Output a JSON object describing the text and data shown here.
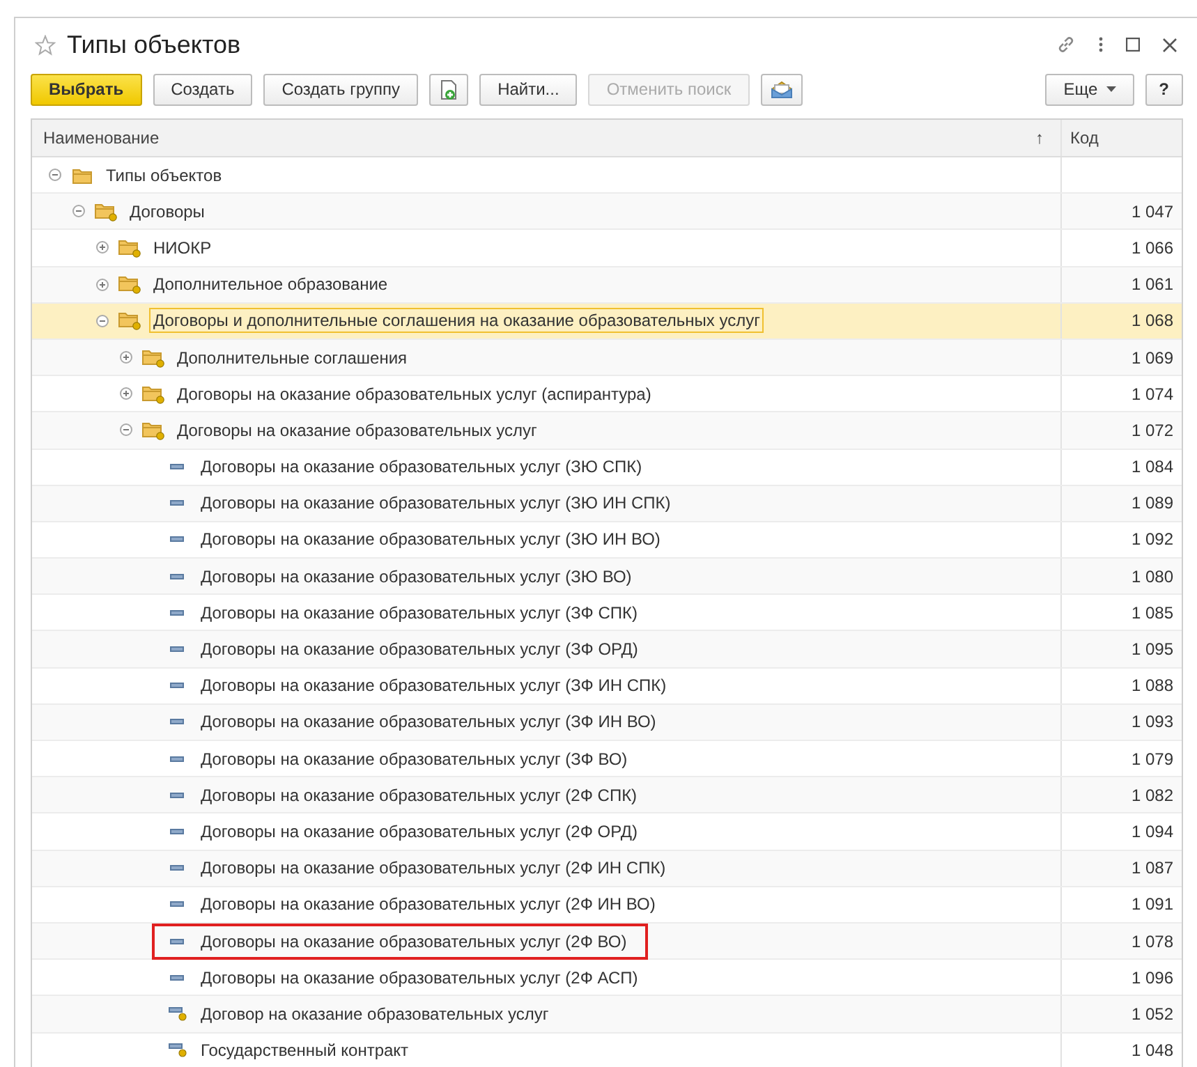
{
  "window": {
    "title": "Типы объектов"
  },
  "toolbar": [
    {
      "kind": "primary",
      "label": "Выбрать",
      "disabled": false
    },
    {
      "kind": "button",
      "label": "Создать",
      "disabled": false
    },
    {
      "kind": "button",
      "label": "Создать группу",
      "disabled": false
    },
    {
      "kind": "doc-icon"
    },
    {
      "kind": "button",
      "label": "Найти...",
      "disabled": false
    },
    {
      "kind": "button",
      "label": "Отменить поиск",
      "disabled": true
    },
    {
      "kind": "envelope-icon"
    }
  ],
  "toolbar_right": {
    "more": "Еще",
    "help": "?"
  },
  "table": {
    "columns": [
      {
        "label": "Наименование",
        "sort_mark": "↑"
      },
      {
        "label": "Код"
      }
    ],
    "rows": [
      {
        "kind": "root-group",
        "name": "Типы объектов",
        "code": "",
        "expanded": true,
        "selected": false,
        "circled": false,
        "children": [
          {
            "kind": "group",
            "name": "Договоры",
            "code": "1 047",
            "expanded": true,
            "selected": false,
            "circled": false,
            "children": [
              {
                "kind": "group",
                "name": "НИОКР",
                "code": "1 066",
                "expanded": false,
                "selected": false,
                "circled": false
              },
              {
                "kind": "group",
                "name": "Дополнительное образование",
                "code": "1 061",
                "expanded": false,
                "selected": false,
                "circled": false
              },
              {
                "kind": "group",
                "name": "Договоры и дополнительные соглашения на оказание образовательных услуг",
                "code": "1 068",
                "expanded": true,
                "selected": true,
                "circled": false,
                "children": [
                  {
                    "kind": "group",
                    "name": "Дополнительные соглашения",
                    "code": "1 069",
                    "expanded": false,
                    "selected": false,
                    "circled": false
                  },
                  {
                    "kind": "group",
                    "name": "Договоры на оказание образовательных услуг (аспирантура)",
                    "code": "1 074",
                    "expanded": false,
                    "selected": false,
                    "circled": false
                  },
                  {
                    "kind": "group",
                    "name": "Договоры на оказание образовательных услуг",
                    "code": "1 072",
                    "expanded": true,
                    "selected": false,
                    "circled": false,
                    "children": [
                      {
                        "kind": "item",
                        "name": "Договоры на оказание образовательных услуг (ЗЮ СПК)",
                        "code": "1 084",
                        "selected": false,
                        "circled": false
                      },
                      {
                        "kind": "item",
                        "name": "Договоры на оказание образовательных услуг (ЗЮ ИН СПК)",
                        "code": "1 089",
                        "selected": false,
                        "circled": false
                      },
                      {
                        "kind": "item",
                        "name": "Договоры на оказание образовательных услуг (ЗЮ ИН ВО)",
                        "code": "1 092",
                        "selected": false,
                        "circled": false
                      },
                      {
                        "kind": "item",
                        "name": "Договоры на оказание образовательных услуг (ЗЮ ВО)",
                        "code": "1 080",
                        "selected": false,
                        "circled": false
                      },
                      {
                        "kind": "item",
                        "name": "Договоры на оказание образовательных услуг (ЗФ СПК)",
                        "code": "1 085",
                        "selected": false,
                        "circled": false
                      },
                      {
                        "kind": "item",
                        "name": "Договоры на оказание образовательных услуг (ЗФ ОРД)",
                        "code": "1 095",
                        "selected": false,
                        "circled": false
                      },
                      {
                        "kind": "item",
                        "name": "Договоры на оказание образовательных услуг (ЗФ ИН СПК)",
                        "code": "1 088",
                        "selected": false,
                        "circled": false
                      },
                      {
                        "kind": "item",
                        "name": "Договоры на оказание образовательных услуг (ЗФ ИН ВО)",
                        "code": "1 093",
                        "selected": false,
                        "circled": false
                      },
                      {
                        "kind": "item",
                        "name": "Договоры на оказание образовательных услуг (ЗФ ВО)",
                        "code": "1 079",
                        "selected": false,
                        "circled": false
                      },
                      {
                        "kind": "item",
                        "name": "Договоры на оказание образовательных услуг (2Ф СПК)",
                        "code": "1 082",
                        "selected": false,
                        "circled": false
                      },
                      {
                        "kind": "item",
                        "name": "Договоры на оказание образовательных услуг (2Ф ОРД)",
                        "code": "1 094",
                        "selected": false,
                        "circled": false
                      },
                      {
                        "kind": "item",
                        "name": "Договоры на оказание образовательных услуг (2Ф ИН СПК)",
                        "code": "1 087",
                        "selected": false,
                        "circled": false
                      },
                      {
                        "kind": "item",
                        "name": "Договоры на оказание образовательных услуг (2Ф ИН ВО)",
                        "code": "1 091",
                        "selected": false,
                        "circled": false
                      },
                      {
                        "kind": "item",
                        "name": "Договоры на оказание образовательных услуг (2Ф ВО)",
                        "code": "1 078",
                        "selected": false,
                        "circled": true
                      },
                      {
                        "kind": "item",
                        "name": "Договоры на оказание образовательных услуг (2Ф АСП)",
                        "code": "1 096",
                        "selected": false,
                        "circled": false
                      },
                      {
                        "kind": "item-marked",
                        "name": "Договор на оказание образовательных услуг",
                        "code": "1 052",
                        "selected": false,
                        "circled": false
                      },
                      {
                        "kind": "item-marked",
                        "name": "Государственный контракт",
                        "code": "1 048",
                        "selected": false,
                        "circled": false
                      }
                    ]
                  }
                ]
              }
            ]
          }
        ]
      }
    ]
  }
}
